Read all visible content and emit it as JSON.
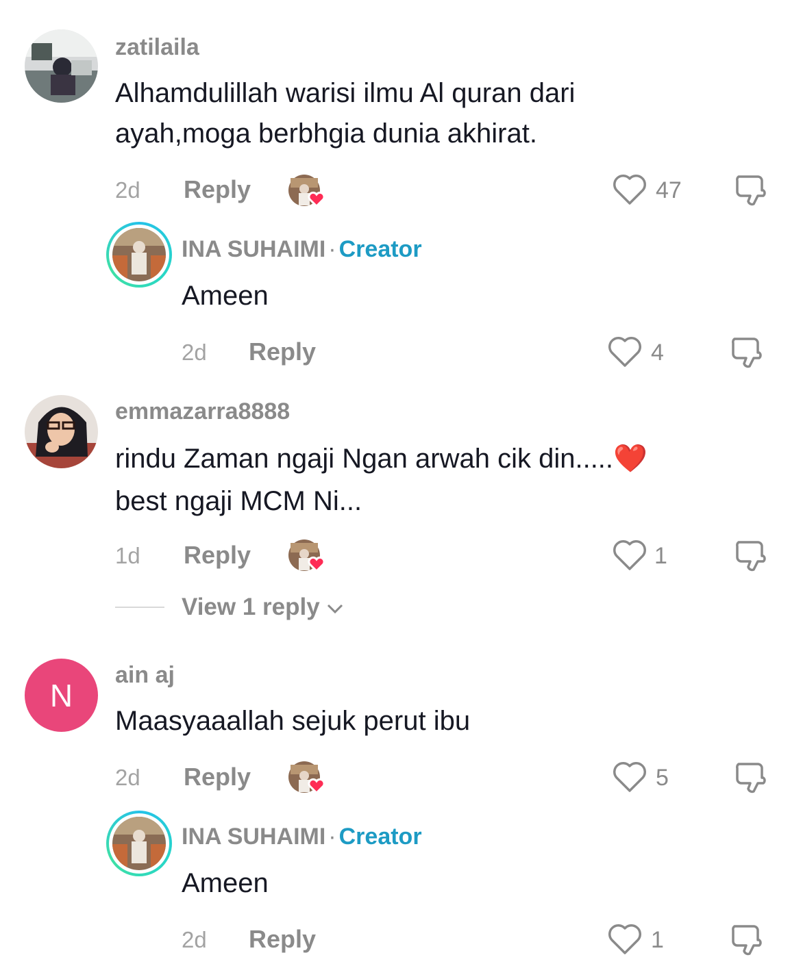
{
  "comments": [
    {
      "username": "zatilaila",
      "text_line1": "Alhamdulillah warisi ilmu Al quran dari",
      "text_line2": "ayah,moga berbhgia dunia akhirat.",
      "time": "2d",
      "reply_label": "Reply",
      "likes": "47",
      "replies": [
        {
          "username": "INA SUHAIMI",
          "separator": "·",
          "badge": "Creator",
          "text": "Ameen",
          "time": "2d",
          "reply_label": "Reply",
          "likes": "4"
        }
      ]
    },
    {
      "username": "emmazarra8888",
      "text_line1": "rindu Zaman ngaji Ngan arwah cik din.....❤️",
      "text_line2": "best ngaji MCM Ni...",
      "time": "1d",
      "reply_label": "Reply",
      "likes": "1",
      "view_replies": "View 1 reply"
    },
    {
      "username": "ain aj",
      "avatar_initial": "N",
      "text_line1": "Maasyaaallah sejuk perut ibu",
      "time": "2d",
      "reply_label": "Reply",
      "likes": "5",
      "replies": [
        {
          "username": "INA SUHAIMI",
          "separator": "·",
          "badge": "Creator",
          "text": "Ameen",
          "time": "2d",
          "reply_label": "Reply",
          "likes": "1"
        }
      ]
    }
  ],
  "colors": {
    "creator_badge": "#1d9bc4",
    "heart_badge": "#fe2c55",
    "initial_avatar_bg": "#e9467a"
  }
}
